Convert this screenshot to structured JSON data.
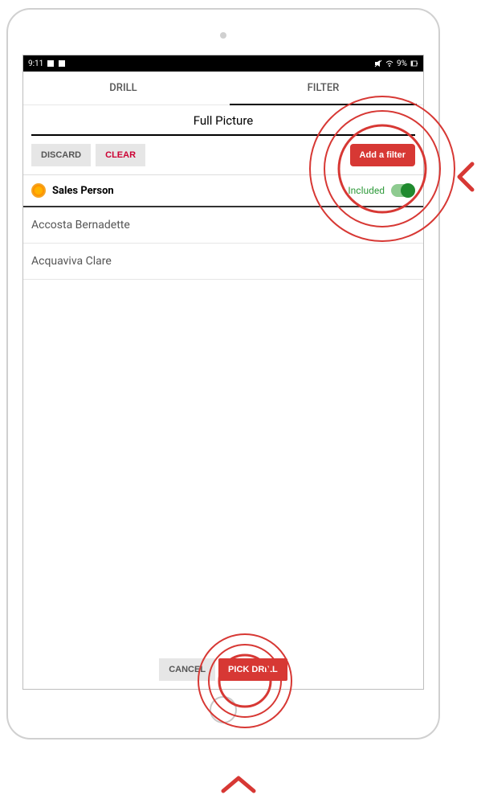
{
  "status": {
    "time": "9:11",
    "battery": "9%"
  },
  "tabs": {
    "drill": "DRILL",
    "filter": "FILTER"
  },
  "title": "Full Picture",
  "toolbar": {
    "discard": "DISCARD",
    "clear": "CLEAR",
    "add_filter": "Add a filter"
  },
  "filter": {
    "name": "Sales Person",
    "included_label": "Included"
  },
  "list": {
    "items": [
      "Accosta Bernadette",
      "Acquaviva Clare"
    ]
  },
  "footer": {
    "cancel": "CANCEL",
    "pick_drill": "PICK DRILL"
  },
  "colors": {
    "accent": "#d73834",
    "included": "#2e9a3a"
  }
}
